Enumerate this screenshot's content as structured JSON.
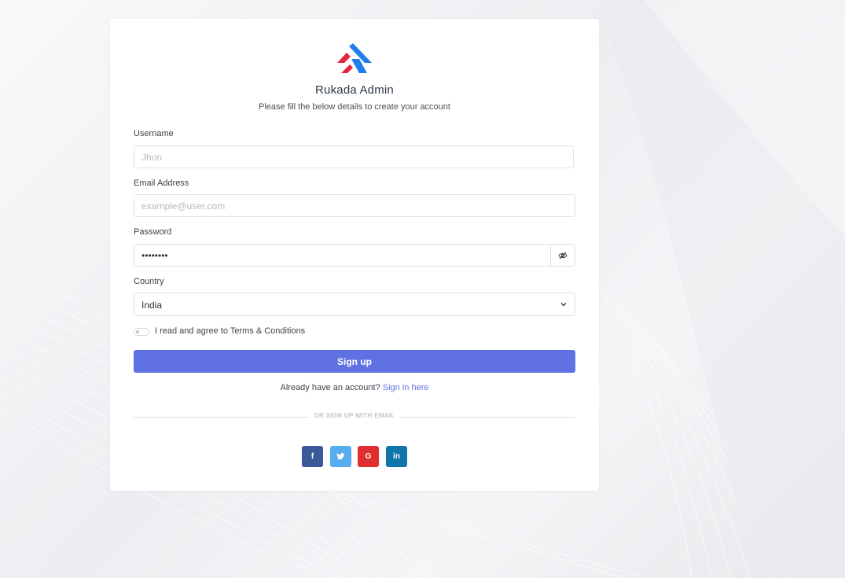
{
  "brand": {
    "name": "Rukada Admin",
    "subtitle": "Please fill the below details to create your account",
    "logo_colors": {
      "red": "#e8253b",
      "blue": "#1f7ef0"
    }
  },
  "form": {
    "username": {
      "label": "Username",
      "placeholder": "Jhon",
      "value": ""
    },
    "email": {
      "label": "Email Address",
      "placeholder": "example@user.com",
      "value": ""
    },
    "password": {
      "label": "Password",
      "value": "12345678",
      "toggle_icon": "eye-slash-icon"
    },
    "country": {
      "label": "Country",
      "value": "India",
      "icon": "chevron-down-icon"
    },
    "terms": {
      "label": "I read and agree to Terms & Conditions",
      "checked": false
    },
    "submit_label": "Sign up"
  },
  "signin": {
    "prompt": "Already have an account?",
    "link": "Sign in here"
  },
  "divider": {
    "text": "OR SIGN UP WITH EMAIL"
  },
  "social": [
    {
      "name": "facebook",
      "glyph": "f",
      "color": "#3b5998"
    },
    {
      "name": "twitter",
      "glyph": "t",
      "color": "#55acee"
    },
    {
      "name": "google",
      "glyph": "G",
      "color": "#e02f2f"
    },
    {
      "name": "linkedin",
      "glyph": "in",
      "color": "#0e76a8"
    }
  ],
  "colors": {
    "primary": "#6072e3",
    "card": "#ffffff"
  }
}
